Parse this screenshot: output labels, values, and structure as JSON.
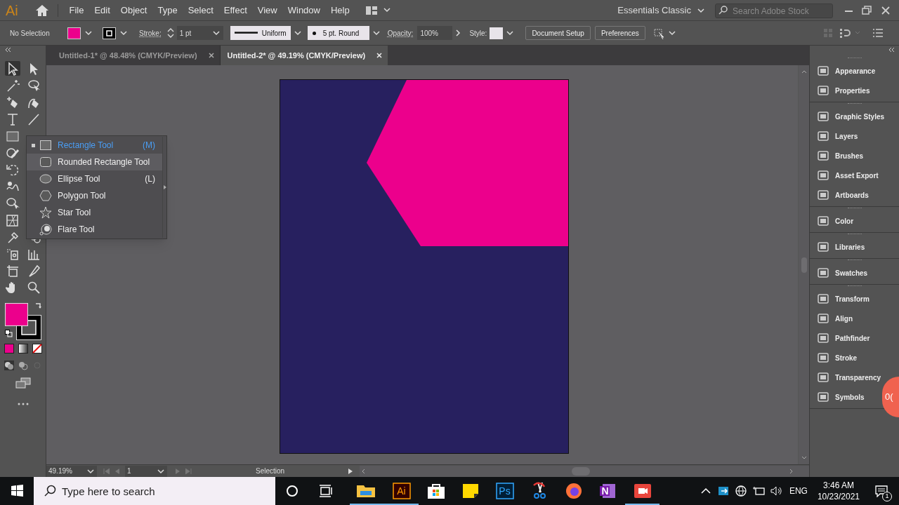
{
  "app_logo": "Ai",
  "menu": [
    "File",
    "Edit",
    "Object",
    "Type",
    "Select",
    "Effect",
    "View",
    "Window",
    "Help"
  ],
  "workspace": "Essentials Classic",
  "stock_search": {
    "placeholder": "Search Adobe Stock"
  },
  "control_bar": {
    "selection": "No Selection",
    "stroke_label": "Stroke:",
    "stroke_weight": "1 pt",
    "profile": "Uniform",
    "brush": "5 pt. Round",
    "opacity_label": "Opacity:",
    "opacity": "100%",
    "style_label": "Style:",
    "buttons": [
      "Document Setup",
      "Preferences"
    ]
  },
  "tabs": [
    {
      "label": "Untitled-1* @ 48.48% (CMYK/Preview)",
      "selected": false
    },
    {
      "label": "Untitled-2* @ 49.19% (CMYK/Preview)",
      "selected": true
    }
  ],
  "flyout": [
    {
      "label": "Rectangle Tool",
      "shortcut": "(M)",
      "kind": "rectangle",
      "selected": true,
      "highlighted": false
    },
    {
      "label": "Rounded Rectangle Tool",
      "kind": "rounded",
      "selected": false,
      "highlighted": true
    },
    {
      "label": "Ellipse Tool",
      "shortcut": "(L)",
      "kind": "ellipse",
      "selected": false,
      "highlighted": false
    },
    {
      "label": "Polygon Tool",
      "kind": "polygon",
      "selected": false,
      "highlighted": false
    },
    {
      "label": "Star Tool",
      "kind": "star",
      "selected": false,
      "highlighted": false
    },
    {
      "label": "Flare Tool",
      "kind": "flare",
      "selected": false,
      "highlighted": false
    }
  ],
  "panels": [
    [
      "Appearance",
      "Properties"
    ],
    [
      "Graphic Styles",
      "Layers",
      "Brushes",
      "Asset Export",
      "Artboards"
    ],
    [
      "Color"
    ],
    [
      "Libraries"
    ],
    [
      "Swatches"
    ],
    [
      "Transform",
      "Align",
      "Pathfinder",
      "Stroke",
      "Transparency",
      "Symbols"
    ]
  ],
  "status_bar": {
    "zoom": "49.19%",
    "artboard": "1",
    "tool": "Selection"
  },
  "recorder_badge": "0(",
  "taskbar": {
    "search": {
      "placeholder": "Type here to search"
    },
    "apps": [
      {
        "kind": "folder",
        "active": true
      },
      {
        "kind": "illustrator",
        "label": "Ai",
        "active": true
      },
      {
        "kind": "store",
        "active": false
      },
      {
        "kind": "notes",
        "active": false
      },
      {
        "kind": "photoshop",
        "label": "Ps",
        "active": false
      },
      {
        "kind": "snip",
        "active": false
      },
      {
        "kind": "firefox",
        "active": false
      },
      {
        "kind": "onenote",
        "label": "N",
        "active": false
      },
      {
        "kind": "recorder",
        "active": true
      }
    ],
    "language": "ENG",
    "time": "3:46 AM",
    "date": "10/23/2021",
    "notifications": "1"
  }
}
